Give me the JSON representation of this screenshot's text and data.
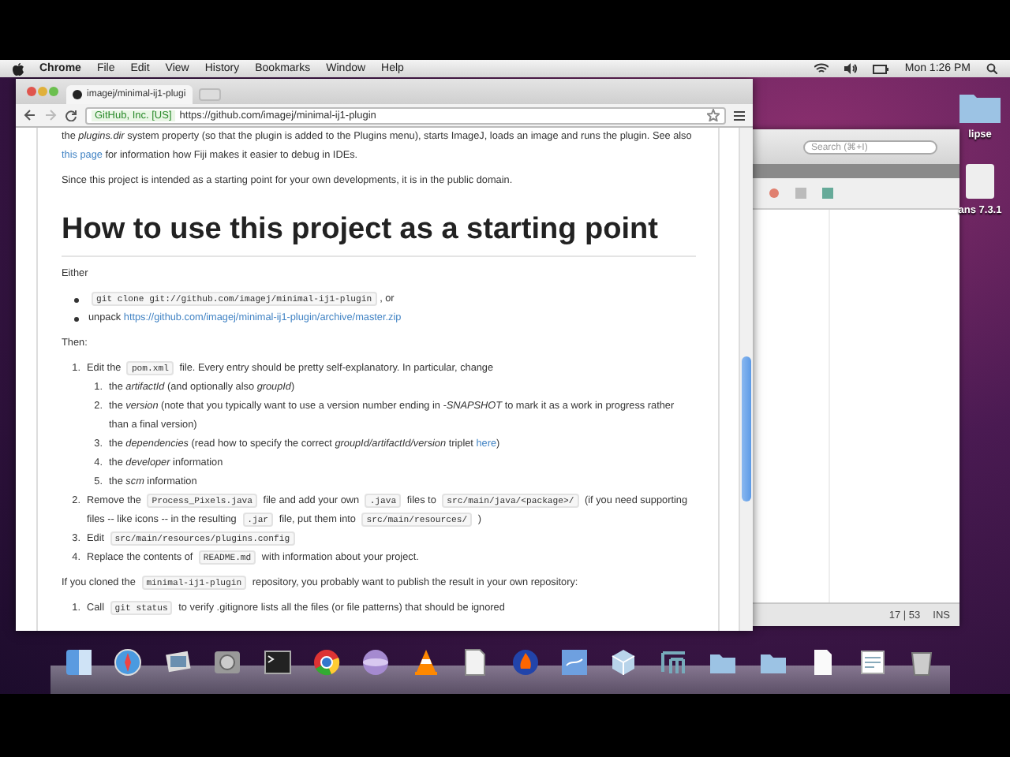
{
  "menubar": {
    "app": "Chrome",
    "menus": [
      "File",
      "Edit",
      "View",
      "History",
      "Bookmarks",
      "Window",
      "Help"
    ],
    "clock": "Mon 1:26 PM"
  },
  "browser": {
    "tab": {
      "title": "imagej/minimal-ij1-plugi",
      "selected": true
    },
    "certificate": "GitHub, Inc. [US]",
    "url": "https://github.com/imagej/minimal-ij1-plugin"
  },
  "readme": {
    "intro": [
      [
        {
          "kind": "text",
          "text": "the *plugins.dir* system property (so that the plugin is added to the Plugins menu), starts ImageJ, loads an image and runs the plugin. See also "
        },
        {
          "kind": "link",
          "text": "this page"
        },
        {
          "kind": "text",
          "text": " for information how Fiji makes it easier to debug in IDEs."
        }
      ],
      [
        {
          "kind": "text",
          "text": "Since this project is intended as a starting point for your own developments, it is in the public domain."
        }
      ]
    ],
    "heading": "How to use this project as a starting point",
    "either": "Either",
    "bullets": [
      [
        {
          "kind": "code",
          "text": "git clone git://github.com/imagej/minimal-ij1-plugin"
        },
        {
          "kind": "text",
          "text": ", or"
        }
      ],
      [
        {
          "kind": "text",
          "text": "unpack "
        },
        {
          "kind": "link",
          "text": "https://github.com/imagej/minimal-ij1-plugin/archive/master.zip"
        }
      ]
    ],
    "then": "Then:",
    "steps": [
      {
        "number": "1.",
        "parts": [
          {
            "kind": "text",
            "text": "Edit the "
          },
          {
            "kind": "code",
            "text": "pom.xml"
          },
          {
            "kind": "text",
            "text": " file. Every entry should be pretty self-explanatory. In particular, change"
          }
        ],
        "children": [
          {
            "number": "1.",
            "parts": [
              {
                "kind": "text",
                "text": "the *artifactId* (and optionally also *groupId*)"
              }
            ]
          },
          {
            "number": "2.",
            "parts": [
              {
                "kind": "text",
                "text": "the *version* (note that you typically want to use a version number ending in *-SNAPSHOT* to mark it as a work in progress rather than a final version)"
              }
            ]
          },
          {
            "number": "3.",
            "parts": [
              {
                "kind": "text",
                "text": "the *dependencies* (read how to specify the correct *groupId/artifactId/version* triplet "
              },
              {
                "kind": "link",
                "text": "here"
              },
              {
                "kind": "text",
                "text": ")"
              }
            ]
          },
          {
            "number": "4.",
            "parts": [
              {
                "kind": "text",
                "text": "the *developer* information"
              }
            ]
          },
          {
            "number": "5.",
            "parts": [
              {
                "kind": "text",
                "text": "the *scm* information"
              }
            ]
          }
        ]
      },
      {
        "number": "2.",
        "parts": [
          {
            "kind": "text",
            "text": "Remove the "
          },
          {
            "kind": "code",
            "text": "Process_Pixels.java"
          },
          {
            "kind": "text",
            "text": " file and add your own "
          },
          {
            "kind": "code",
            "text": ".java"
          },
          {
            "kind": "text",
            "text": " files to "
          },
          {
            "kind": "code",
            "text": "src/main/java/<package>/"
          },
          {
            "kind": "text",
            "text": " (if you need supporting files -- like icons -- in the resulting "
          },
          {
            "kind": "code",
            "text": ".jar"
          },
          {
            "kind": "text",
            "text": " file, put them into "
          },
          {
            "kind": "code",
            "text": "src/main/resources/"
          },
          {
            "kind": "text",
            "text": " )"
          }
        ]
      },
      {
        "number": "3.",
        "parts": [
          {
            "kind": "text",
            "text": "Edit "
          },
          {
            "kind": "code",
            "text": "src/main/resources/plugins.config"
          }
        ]
      },
      {
        "number": "4.",
        "parts": [
          {
            "kind": "text",
            "text": "Replace the contents of "
          },
          {
            "kind": "code",
            "text": "README.md"
          },
          {
            "kind": "text",
            "text": " with information about your project."
          }
        ]
      }
    ],
    "cloned": [
      {
        "kind": "text",
        "text": "If you cloned the "
      },
      {
        "kind": "code",
        "text": "minimal-ij1-plugin"
      },
      {
        "kind": "text",
        "text": " repository, you probably want to publish the result in your own repository:"
      }
    ],
    "publish_steps": [
      {
        "number": "1.",
        "parts": [
          {
            "kind": "text",
            "text": "Call "
          },
          {
            "kind": "code",
            "text": "git status"
          },
          {
            "kind": "text",
            "text": " to verify .gitignore lists all the files (or file patterns) that should be ignored"
          }
        ]
      }
    ]
  },
  "ide": {
    "search": {
      "placeholder": "Search (⌘+I)"
    },
    "position": "17 | 53",
    "mode": "INS"
  },
  "desktop_icons": [
    {
      "label": "lipse",
      "kind": "folder"
    },
    {
      "label": "ans 7.3.1",
      "kind": "drive"
    }
  ]
}
